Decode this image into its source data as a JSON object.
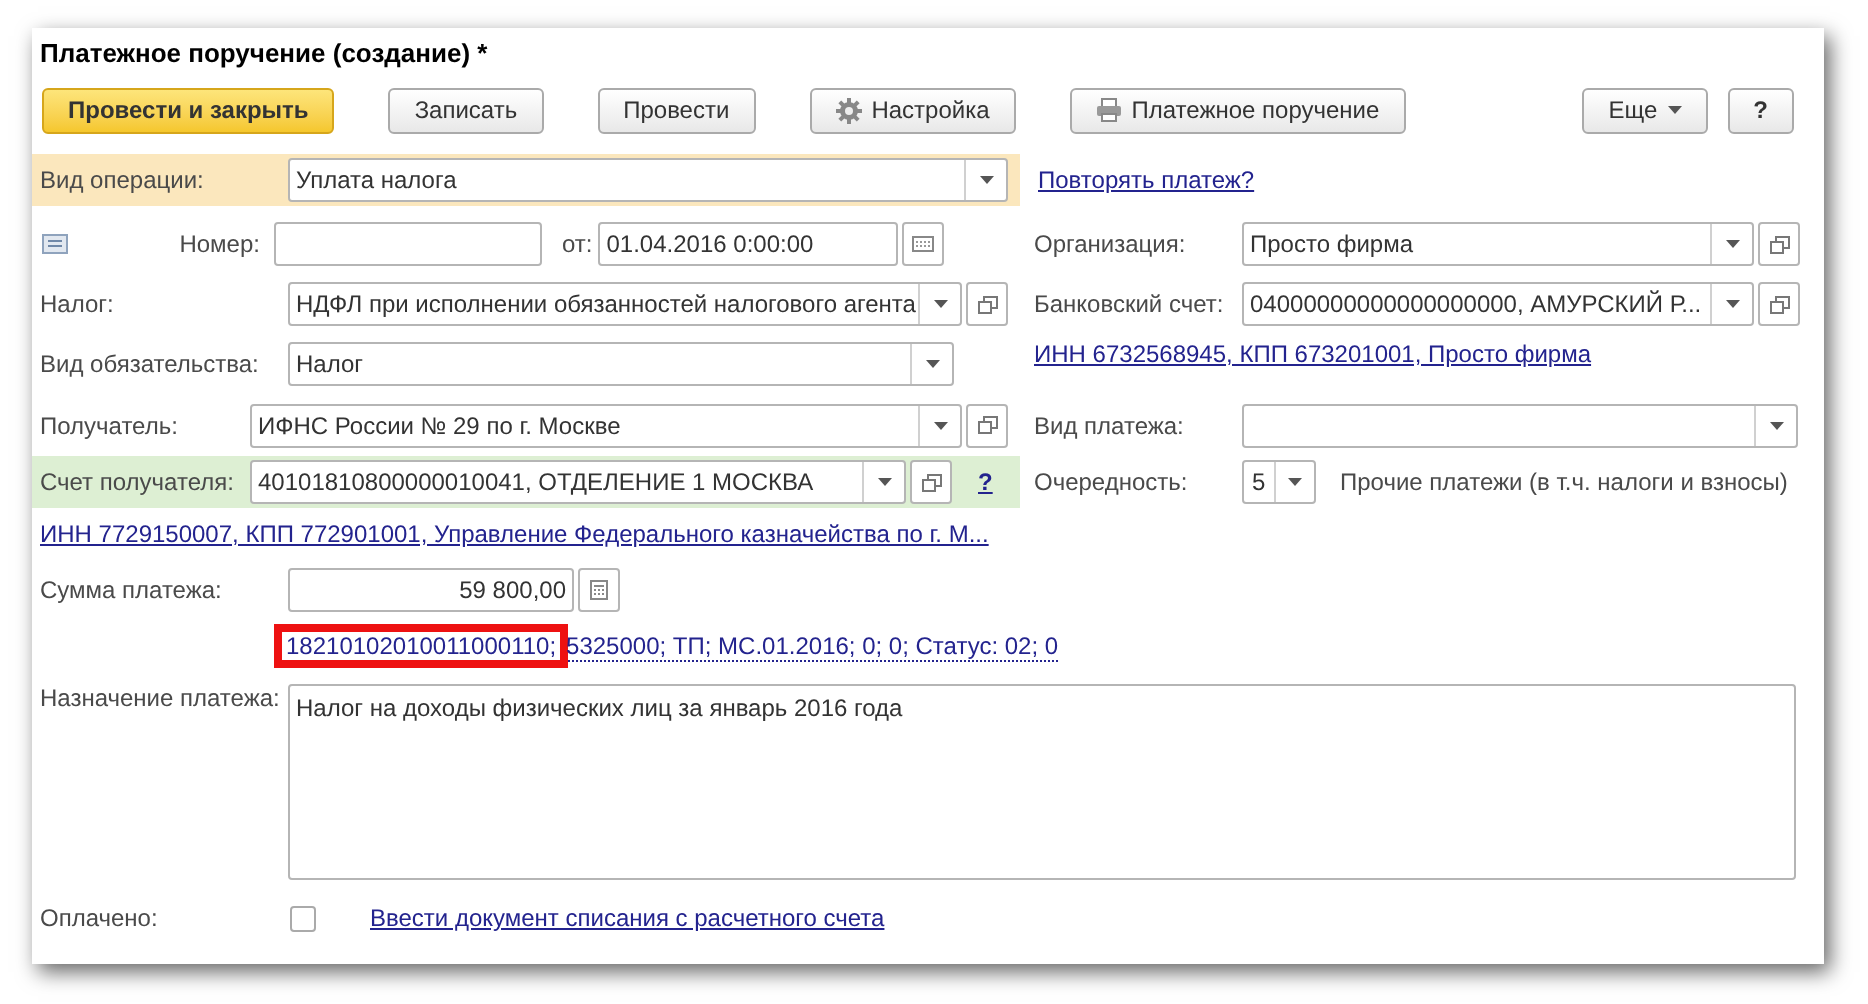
{
  "window": {
    "title": "Платежное поручение (создание) *"
  },
  "toolbar": [
    {
      "label": "Провести и закрыть",
      "kind": "primary"
    },
    {
      "label": "Записать",
      "kind": "plain"
    },
    {
      "label": "Провести",
      "kind": "plain"
    },
    {
      "label": "Настройка",
      "kind": "settings"
    },
    {
      "label": "Платежное поручение",
      "kind": "print"
    },
    {
      "label": "Еще",
      "kind": "menu"
    },
    {
      "label": "?",
      "kind": "help"
    }
  ],
  "operation_type": {
    "label": "Вид операции:",
    "value": "Уплата налога"
  },
  "repeat_payment_link": "Повторять платеж?",
  "number": {
    "label": "Номер:"
  },
  "date": {
    "label": "от:",
    "value": "01.04.2016  0:00:00"
  },
  "organization": {
    "label": "Организация:",
    "value": "Просто фирма"
  },
  "tax": {
    "label": "Налог:",
    "value": "НДФЛ при исполнении обязанностей налогового агента"
  },
  "bank_account": {
    "label": "Банковский счет:",
    "value": "04000000000000000000, АМУРСКИЙ Р..."
  },
  "obligation_type": {
    "label": "Вид обязательства:",
    "value": "Налог"
  },
  "organization_details_link": "ИНН 6732568945, КПП 673201001, Просто фирма",
  "recipient": {
    "label": "Получатель:",
    "value": "ИФНС России № 29 по г. Москве"
  },
  "payment_type": {
    "label": "Вид платежа:"
  },
  "recipient_account": {
    "label": "Счет получателя:",
    "value": "40101810800000010041, ОТДЕЛЕНИЕ 1 МОСКВА",
    "help": "?"
  },
  "priority": {
    "label": "Очередность:",
    "value": "5",
    "description": "Прочие платежи (в т.ч. налоги и взносы)"
  },
  "recipient_details_link": "ИНН 7729150007, КПП 772901001, Управление Федерального казначейства по г. М...",
  "amount": {
    "label": "Сумма платежа:",
    "value": "59 800,00"
  },
  "tax_details_link": [
    {
      "text": "18210102010011000110;",
      "highlighted": true
    },
    {
      "text": "5325000; ТП; МС.01.2016; 0; 0; Статус: 02; 0",
      "highlighted": false
    }
  ],
  "purpose": {
    "label": "Назначение платежа:",
    "value": "Налог на доходы физических лиц за январь 2016 года"
  },
  "paid": {
    "label": "Оплачено:",
    "checked": false
  },
  "write_off_link": "Ввести документ списания с расчетного счета"
}
